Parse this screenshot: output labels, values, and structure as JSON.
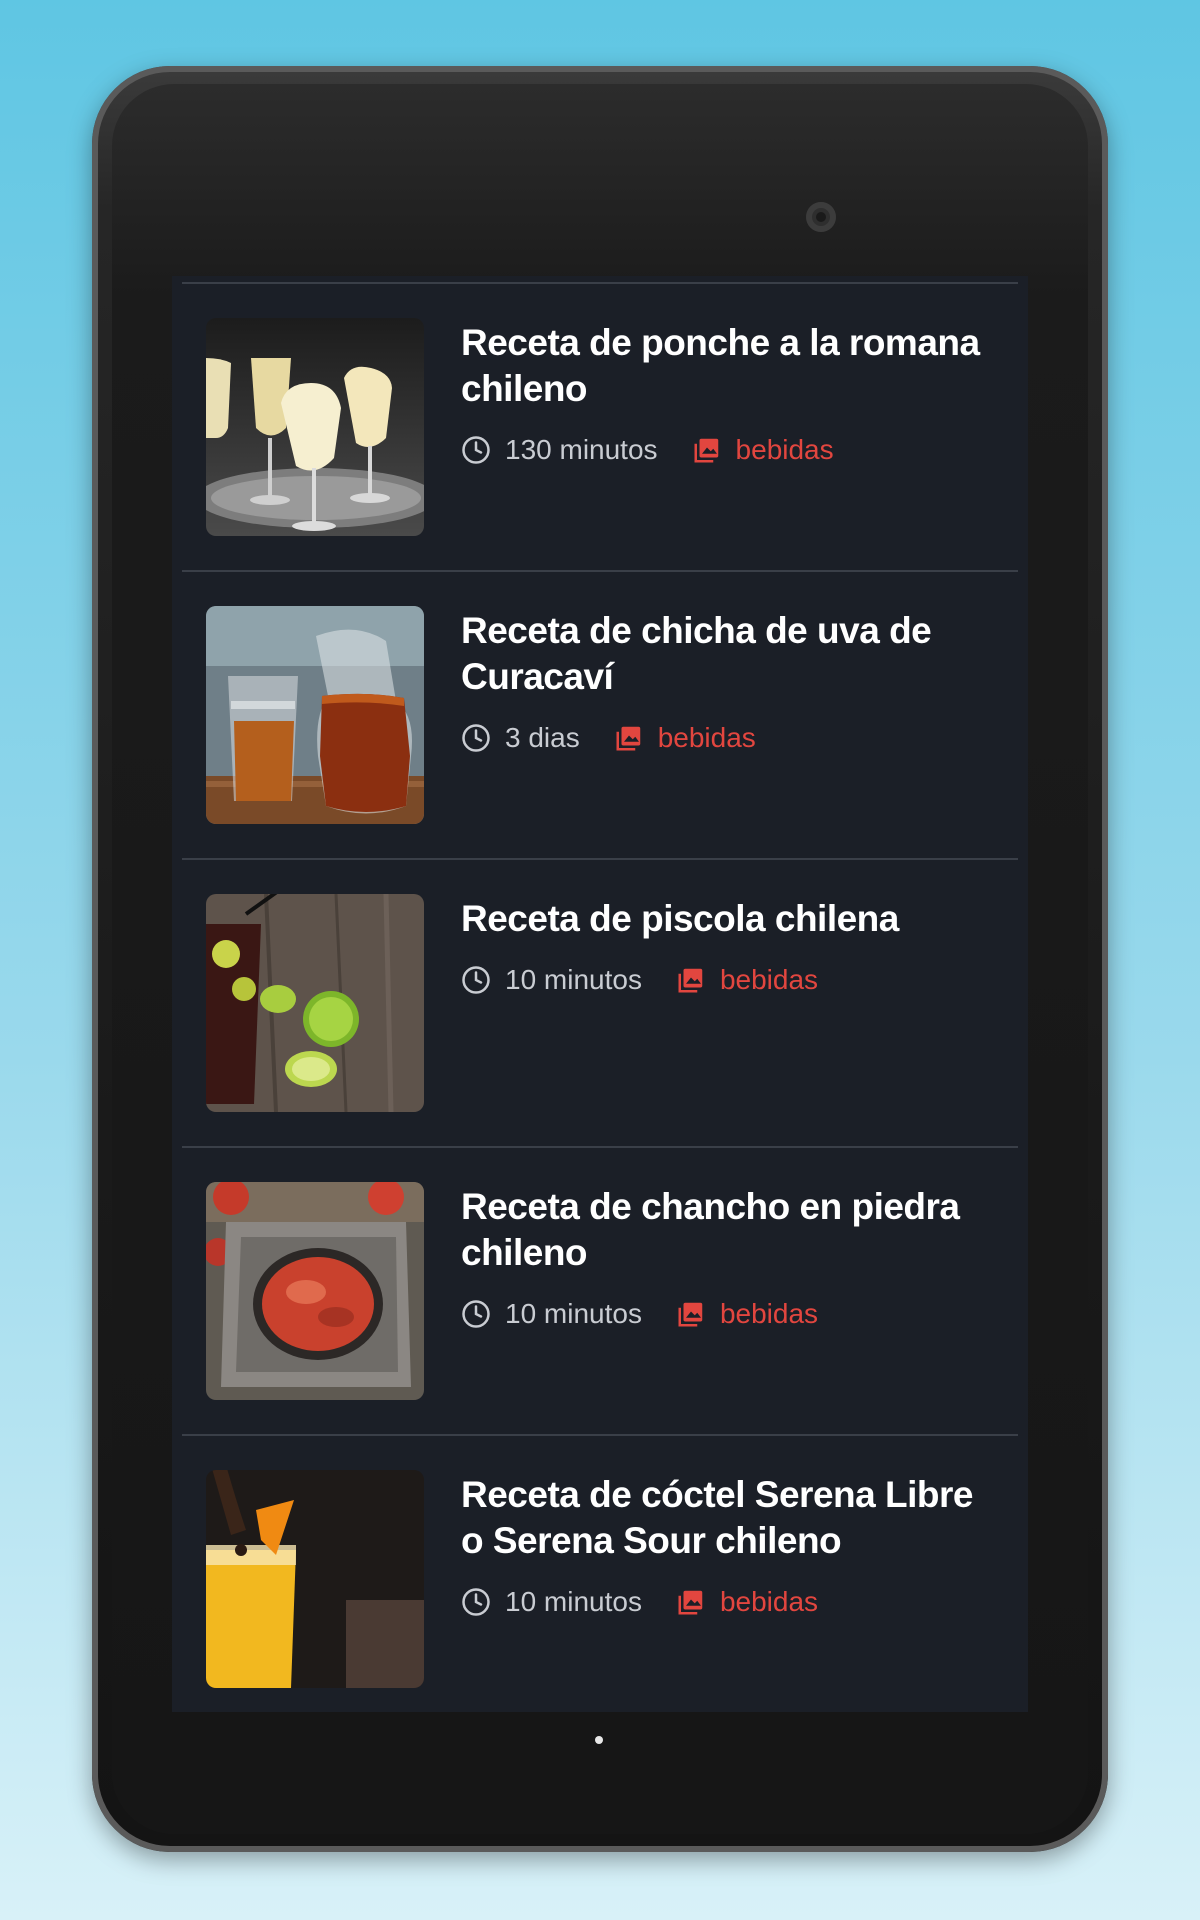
{
  "recipes": [
    {
      "title": "Receta de ponche a la romana chileno",
      "time": "130 minutos",
      "category": "bebidas",
      "clock_icon": "clock-icon",
      "category_icon": "image-icon",
      "accent": "#e2463f"
    },
    {
      "title": "Receta de chicha de uva de Curacaví",
      "time": "3 dias",
      "category": "bebidas",
      "clock_icon": "clock-icon",
      "category_icon": "image-icon",
      "accent": "#e2463f"
    },
    {
      "title": "Receta de piscola chilena",
      "time": "10 minutos",
      "category": "bebidas",
      "clock_icon": "clock-icon",
      "category_icon": "image-icon",
      "accent": "#e2463f"
    },
    {
      "title": "Receta de chancho en piedra chileno",
      "time": "10 minutos",
      "category": "bebidas",
      "clock_icon": "clock-icon",
      "category_icon": "image-icon",
      "accent": "#e2463f"
    },
    {
      "title": "Receta de cóctel Serena Libre o Serena Sour chileno",
      "time": "10 minutos",
      "category": "bebidas",
      "clock_icon": "clock-icon",
      "category_icon": "image-icon",
      "accent": "#e2463f"
    }
  ],
  "colors": {
    "screen_bg": "#1b1f27",
    "title": "#ffffff",
    "meta_text": "#c9ccd2",
    "category": "#e2463f",
    "divider": "#3a3f48"
  }
}
